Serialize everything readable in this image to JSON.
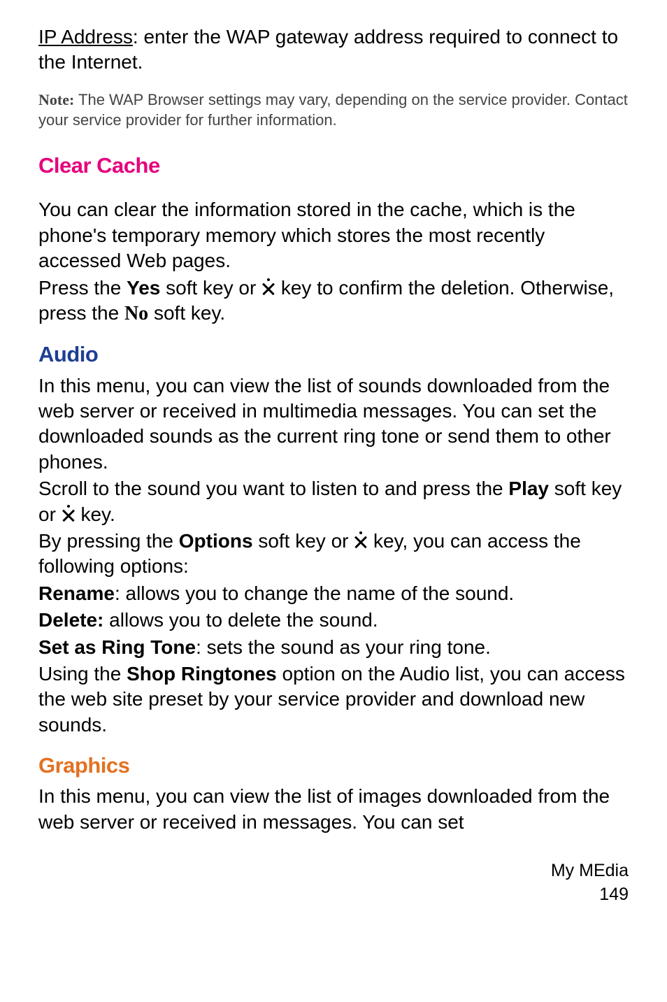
{
  "intro": {
    "ip_label": "IP Address",
    "ip_text": ": enter the WAP gateway address required to connect to the Internet."
  },
  "note": {
    "label": "Note:",
    "text": " The WAP Browser settings may vary, depending on the service provider. Contact your service provider for further information."
  },
  "clear_cache": {
    "heading": "Clear Cache",
    "p1": "You can clear the information stored in the cache, which is the phone's temporary memory which stores the most recently accessed Web pages.",
    "p2a": "Press the ",
    "p2_yes": "Yes",
    "p2b": " soft key or ",
    "p2c": " key to confirm the deletion. Otherwise, press the ",
    "p2_no": "No",
    "p2d": " soft key."
  },
  "audio": {
    "heading": "Audio",
    "p1": "In this menu, you can view the list of sounds downloaded from the web server or received in multimedia messages. You can set the downloaded sounds as the current ring tone or send them to other phones.",
    "p2a": "Scroll to the sound you want to listen to and press the ",
    "p2_play": "Play",
    "p2b": " soft key or ",
    "p2c": " key.",
    "p3a": "By pressing the ",
    "p3_options": "Options",
    "p3b": " soft key or ",
    "p3c": " key, you can access the following options:",
    "rename_label": "Rename",
    "rename_text": ": allows you to change the name of the sound.",
    "delete_label": "Delete:",
    "delete_text": " allows you to delete the sound.",
    "ringtone_label": "Set as Ring Tone",
    "ringtone_text": ": sets the sound as your ring tone.",
    "p4a": "Using the ",
    "p4_shop": "Shop Ringtones",
    "p4b": " option on the Audio list, you can access the web site preset by your service provider and download new sounds."
  },
  "graphics": {
    "heading": "Graphics",
    "p1": "In this menu, you can view the list of images downloaded from the web server or received in messages. You can set"
  },
  "footer": {
    "title": "My MEdia",
    "page": "149"
  }
}
